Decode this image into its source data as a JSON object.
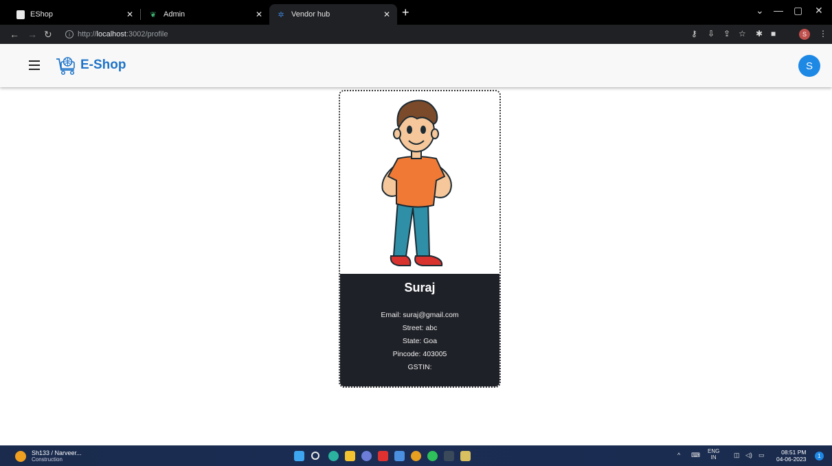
{
  "browser": {
    "tabs": [
      {
        "title": "EShop"
      },
      {
        "title": "Admin"
      },
      {
        "title": "Vendor hub"
      }
    ],
    "url": {
      "scheme": "http://",
      "host": "localhost",
      "rest": ":3002/profile"
    },
    "profile_initial": "S"
  },
  "app": {
    "logo_text": "E-Shop",
    "user_initial": "S",
    "brand_color": "#1e73c8"
  },
  "profile": {
    "name": "Suraj",
    "email": "Email: suraj@gmail.com",
    "street": "Street: abc",
    "state": "State: Goa",
    "pincode": "Pincode: 403005",
    "gstin": "GSTIN:"
  },
  "taskbar": {
    "weather_line1": "Sh133 / Narveer...",
    "weather_line2": "Construction",
    "lang_line1": "ENG",
    "lang_line2": "IN",
    "time": "08:51 PM",
    "date": "04-06-2023",
    "notification_count": "1"
  }
}
